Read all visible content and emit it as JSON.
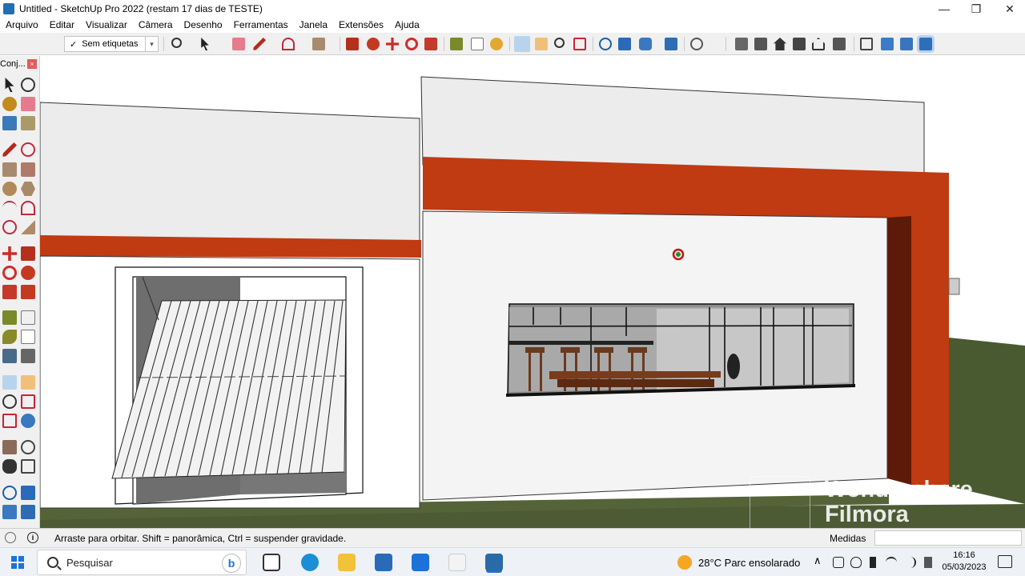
{
  "window": {
    "title": "Untitled - SketchUp Pro 2022 (restam 17 dias de TESTE)",
    "minimize_glyph": "—",
    "maximize_glyph": "❐",
    "close_glyph": "✕"
  },
  "menu": [
    "Arquivo",
    "Editar",
    "Visualizar",
    "Câmera",
    "Desenho",
    "Ferramentas",
    "Janela",
    "Extensões",
    "Ajuda"
  ],
  "toolbar": {
    "tag_check": "✓",
    "tag_value": "Sem etiquetas",
    "tag_arrow": "▾",
    "icons": [
      "zoom-icon",
      "select-icon",
      "eraser-icon",
      "pencil-icon",
      "arc-icon",
      "rectangle-icon",
      "push-pull-icon",
      "follow-me-icon",
      "move-icon",
      "rotate-icon",
      "scale-icon",
      "tape-icon",
      "text-icon",
      "paint-icon",
      "orbit-icon",
      "pan-icon",
      "zoom-icon",
      "zoom-extents-icon",
      "warehouse-icon",
      "extension-icon",
      "layers-icon",
      "sandbox-icon",
      "profile-icon",
      "iso-view-icon",
      "top-view-icon",
      "front-view-icon",
      "right-view-icon",
      "back-view-icon",
      "left-view-icon",
      "section-icon",
      "xray-icon",
      "wireframe-icon",
      "shaded-icon"
    ]
  },
  "left_panel": {
    "title": "Conj...",
    "close_glyph": "×"
  },
  "status": {
    "message": "Arraste para orbitar. Shift = panorâmica, Ctrl = suspender gravidade.",
    "info_glyph": "i",
    "measure_label": "Medidas",
    "measure_value": ""
  },
  "taskbar": {
    "search_placeholder": "Pesquisar",
    "bing_glyph": "b",
    "weather": "28°C  Parc ensolarado",
    "tray_caret": "∧",
    "time": "16:16",
    "date": "05/03/2023"
  },
  "watermark": {
    "line1": "Wondershare",
    "line2": "Filmora"
  },
  "colors": {
    "accent_red": "#c03a12",
    "dark_red": "#5e1a08",
    "wall": "#ededed",
    "ground": "#4a5a32",
    "sky": "#ffffff"
  }
}
